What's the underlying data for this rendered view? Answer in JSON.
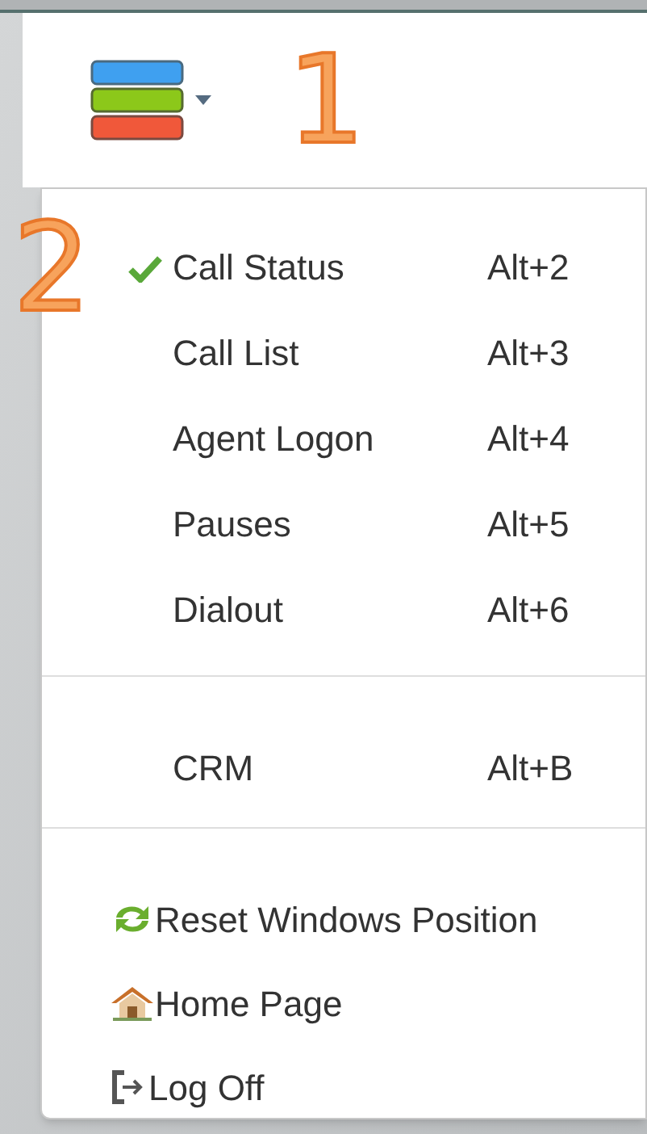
{
  "annotations": [
    {
      "label": "1"
    },
    {
      "label": "2"
    }
  ],
  "menu": {
    "groups": [
      {
        "items": [
          {
            "kind": "check",
            "label": "Call Status",
            "shortcut": "Alt+2",
            "checked": true
          },
          {
            "kind": "check",
            "label": "Call List",
            "shortcut": "Alt+3",
            "checked": false
          },
          {
            "kind": "check",
            "label": "Agent Logon",
            "shortcut": "Alt+4",
            "checked": false
          },
          {
            "kind": "check",
            "label": "Pauses",
            "shortcut": "Alt+5",
            "checked": false
          },
          {
            "kind": "check",
            "label": "Dialout",
            "shortcut": "Alt+6",
            "checked": false
          }
        ]
      },
      {
        "items": [
          {
            "kind": "check",
            "label": "CRM",
            "shortcut": "Alt+B",
            "checked": false
          }
        ]
      },
      {
        "items": [
          {
            "kind": "refresh",
            "label": "Reset Windows Position"
          },
          {
            "kind": "home",
            "label": "Home Page"
          },
          {
            "kind": "logoff",
            "label": "Log Off"
          }
        ]
      }
    ]
  }
}
